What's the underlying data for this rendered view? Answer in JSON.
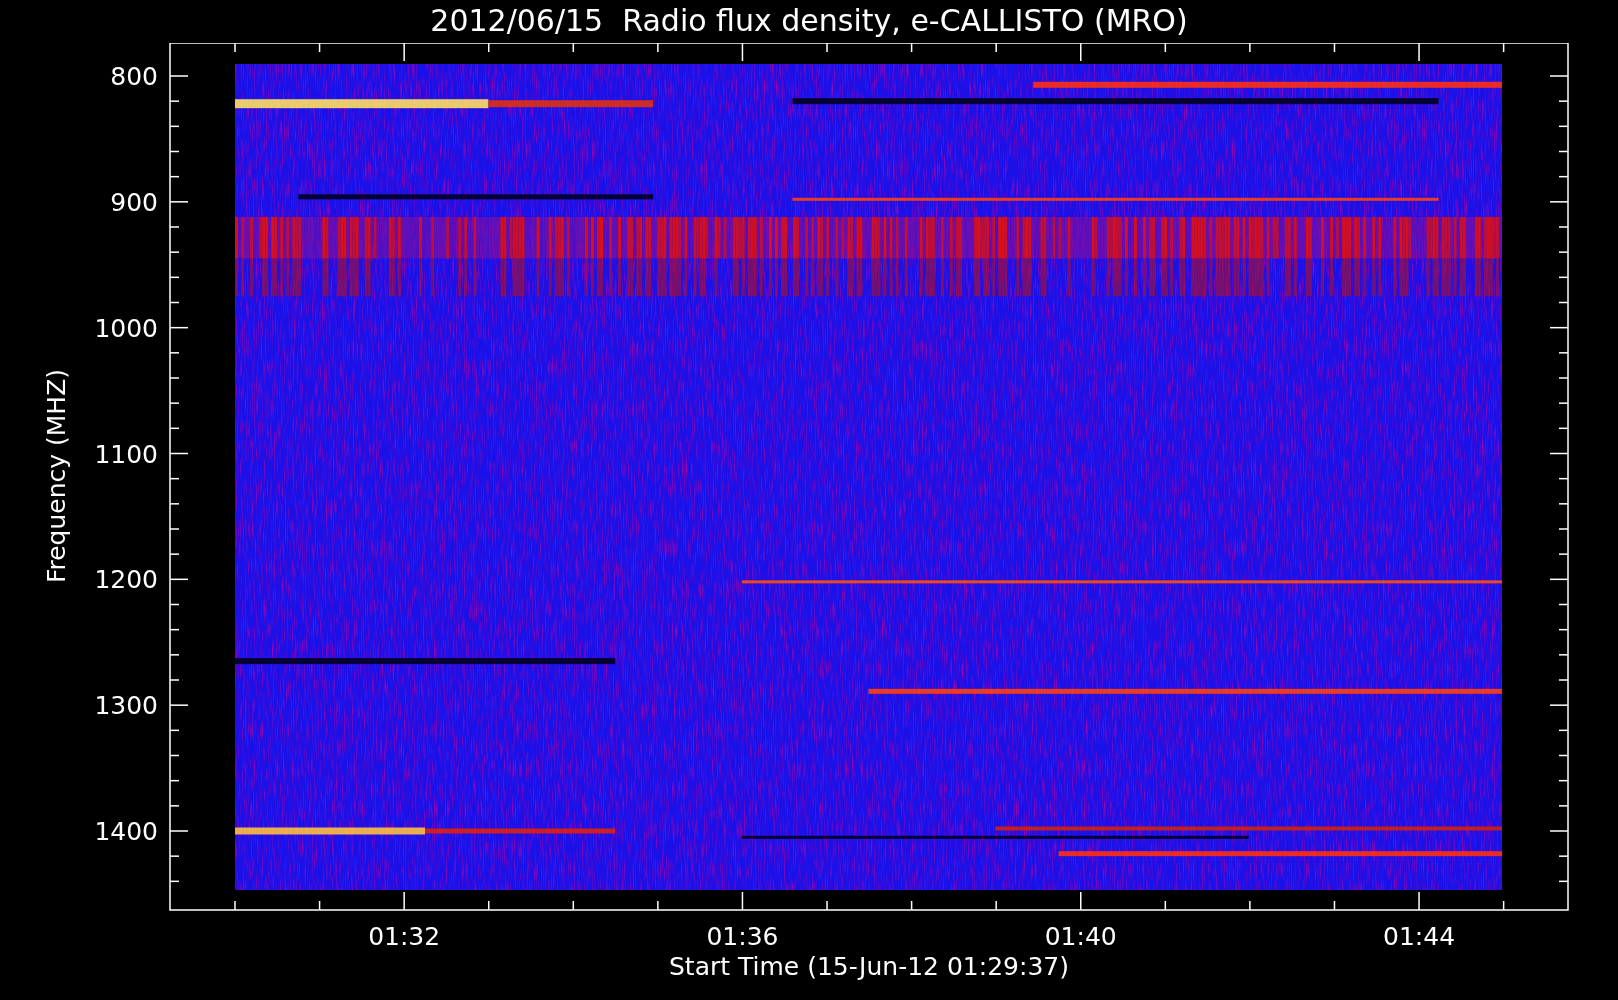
{
  "title": "2012/06/15  Radio flux density, e-CALLISTO (MRO)",
  "plot": {
    "ylabel": "Frequency (MHZ)",
    "xlabel": "Start Time (15-Jun-12 01:29:37)",
    "yticks": [
      "800",
      "900",
      "1000",
      "1100",
      "1200",
      "1300",
      "1400"
    ],
    "xticks": [
      "01:32",
      "01:36",
      "01:40",
      "01:44"
    ]
  }
}
